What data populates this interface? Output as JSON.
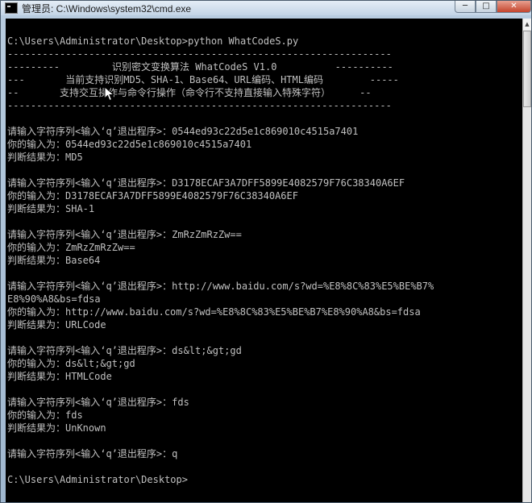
{
  "window": {
    "title": "管理员: C:\\Windows\\system32\\cmd.exe",
    "minimize": "─",
    "maximize": "□",
    "close": "✕"
  },
  "console": {
    "lines": [
      "C:\\Users\\Administrator\\Desktop>python WhatCodeS.py",
      "------------------------------------------------------------------",
      "---------         识别密文变换算法 WhatCodeS V1.0          ----------",
      "---       当前支持识别MD5、SHA-1、Base64、URL编码、HTML编码        -----",
      "--       支持交互操作与命令行操作（命令行不支持直接输入特殊字符）     --",
      "------------------------------------------------------------------",
      "",
      "请输入字符序列<输入‘q’退出程序>：0544ed93c22d5e1c869010c4515a7401",
      "你的输入为：0544ed93c22d5e1c869010c4515a7401",
      "判断结果为：MD5",
      "",
      "请输入字符序列<输入‘q’退出程序>：D3178ECAF3A7DFF5899E4082579F76C38340A6EF",
      "你的输入为：D3178ECAF3A7DFF5899E4082579F76C38340A6EF",
      "判断结果为：SHA-1",
      "",
      "请输入字符序列<输入‘q’退出程序>：ZmRzZmRzZw==",
      "你的输入为：ZmRzZmRzZw==",
      "判断结果为：Base64",
      "",
      "请输入字符序列<输入‘q’退出程序>：http://www.baidu.com/s?wd=%E8%8C%83%E5%BE%B7%",
      "E8%90%A8&bs=fdsa",
      "你的输入为：http://www.baidu.com/s?wd=%E8%8C%83%E5%BE%B7%E8%90%A8&bs=fdsa",
      "判断结果为：URLCode",
      "",
      "请输入字符序列<输入‘q’退出程序>：ds&lt;&gt;gd",
      "你的输入为：ds&lt;&gt;gd",
      "判断结果为：HTMLCode",
      "",
      "请输入字符序列<输入‘q’退出程序>：fds",
      "你的输入为：fds",
      "判断结果为：UnKnown",
      "",
      "请输入字符序列<输入‘q’退出程序>：q",
      "",
      "C:\\Users\\Administrator\\Desktop>"
    ]
  },
  "scrollbar": {
    "up_arrow": "▲"
  }
}
